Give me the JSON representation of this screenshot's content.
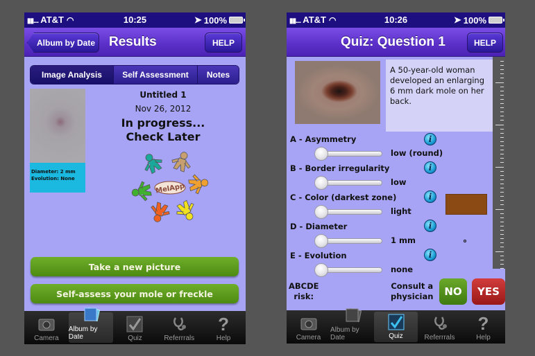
{
  "left_screen": {
    "status": {
      "carrier": "AT&T",
      "time": "10:25",
      "battery": "100%"
    },
    "nav": {
      "back_label": "Album by Date",
      "title": "Results",
      "help_label": "HELP"
    },
    "segments": [
      {
        "label": "Image Analysis",
        "active": true
      },
      {
        "label": "Self Assessment",
        "active": false
      },
      {
        "label": "Notes",
        "active": false
      }
    ],
    "thumbnail": {
      "diameter": "Diameter: 2 mm",
      "evolution": "Evolution: None"
    },
    "result": {
      "name": "Untitled 1",
      "date": "Nov 26, 2012",
      "status_line1": "In progress...",
      "status_line2": "Check Later"
    },
    "logo_text": "MelApp",
    "buttons": {
      "take_picture": "Take a new picture",
      "self_assess": "Self-assess your mole or freckle"
    },
    "tabs": [
      {
        "label": "Camera",
        "icon": "camera-icon",
        "active": false
      },
      {
        "label": "Album by Date",
        "icon": "photo-album-icon",
        "active": true
      },
      {
        "label": "Quiz",
        "icon": "checkmark-icon",
        "active": false
      },
      {
        "label": "Referrrals",
        "icon": "stethoscope-icon",
        "active": false
      },
      {
        "label": "Help",
        "icon": "question-mark-icon",
        "active": false
      }
    ]
  },
  "right_screen": {
    "status": {
      "carrier": "AT&T",
      "time": "10:26",
      "battery": "100%"
    },
    "nav": {
      "title": "Quiz: Question 1",
      "help_label": "HELP"
    },
    "question": "A 50-year-old woman developed an enlarging 6 mm dark mole on her back.",
    "criteria": [
      {
        "label": "A - Asymmetry",
        "value": "low (round)",
        "slider_fraction": 0
      },
      {
        "label": "B - Border irregularity",
        "value": "low",
        "slider_fraction": 0
      },
      {
        "label": "C - Color (darkest zone)",
        "value": "light",
        "slider_fraction": 0
      },
      {
        "label": "D - Diameter",
        "value": "1 mm",
        "slider_fraction": 0
      },
      {
        "label": "E - Evolution",
        "value": "none",
        "slider_fraction": 0
      }
    ],
    "color_swatch": "#8b4a14",
    "abcde_label_1": "ABCDE",
    "abcde_label_2": "risk:",
    "consult_1": "Consult a",
    "consult_2": "physician",
    "no_label": "NO",
    "yes_label": "YES",
    "tabs": [
      {
        "label": "Camera",
        "icon": "camera-icon",
        "active": false
      },
      {
        "label": "Album by Date",
        "icon": "photo-album-icon",
        "active": false
      },
      {
        "label": "Quiz",
        "icon": "checkmark-icon",
        "active": true
      },
      {
        "label": "Referrrals",
        "icon": "stethoscope-icon",
        "active": false
      },
      {
        "label": "Help",
        "icon": "question-mark-icon",
        "active": false
      }
    ]
  }
}
